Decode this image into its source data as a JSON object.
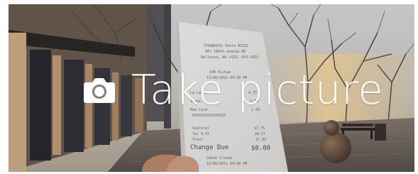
{
  "screen": {
    "prompt_label": "Take picture",
    "prompt_icon": "camera-icon"
  },
  "receipt": {
    "store_name": "STARBUCKS Store #3311",
    "store_address_1": "807 108th Avenue NE",
    "store_address_2": "Bellevue, WA (425) 643-1032",
    "order_type": "CHK Pickup",
    "date_time": "12/06/2012 04:00 PM",
    "line_item_1": "Lg Latte",
    "line_item_1_price": "4.75",
    "line_item_2": "Scone",
    "line_item_2_price": "1.50",
    "line_item_3": "Rew Card",
    "line_item_3_price": "1.50",
    "card_number": "XXXXXXXXXXXX5415",
    "subtotal_label": "Subtotal",
    "subtotal_value": "$7.75",
    "tax_label": "Tax 9.5%",
    "tax_value": "$0.17",
    "total_label": "Total",
    "total_value": "$7.92",
    "change_label": "Change Due",
    "change_value": "$0.00",
    "footer_1": "Check Closed",
    "footer_2": "12/06/2012 04:00 PM"
  }
}
